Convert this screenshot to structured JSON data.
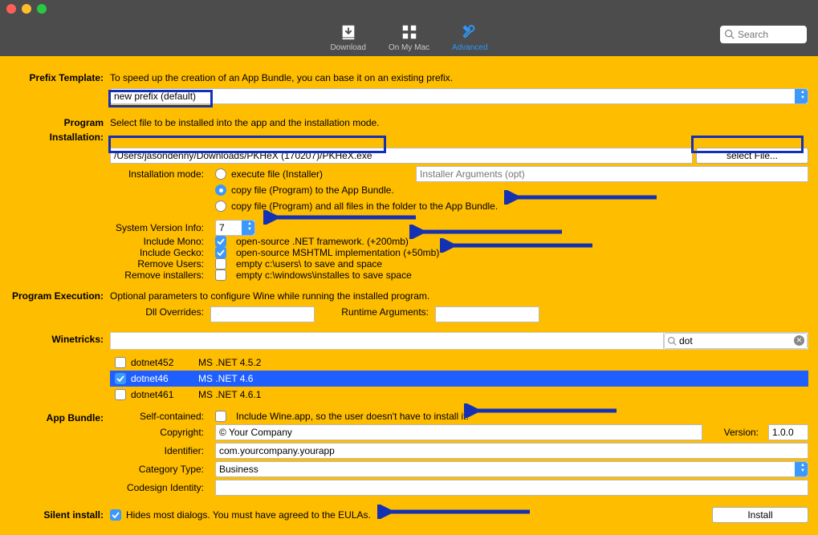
{
  "window": {
    "tabs": [
      "Download",
      "On My Mac",
      "Advanced"
    ],
    "search_placeholder": "Search"
  },
  "prefix": {
    "label": "Prefix Template:",
    "hint": "To speed up the creation of an App Bundle, you can base it on an existing prefix.",
    "value": "new prefix (default)"
  },
  "install": {
    "label": "Program Installation:",
    "hint": "Select file to be installed into the app and the installation mode.",
    "path": "/Users/jasondenny/Downloads/PKHeX (170207)/PKHeX.exe",
    "select_file_btn": "select File...",
    "mode_label": "Installation mode:",
    "modes": [
      "execute file (Installer)",
      "copy file (Program)  to the App Bundle.",
      "copy file (Program)  and all files in the folder to the App Bundle."
    ],
    "installer_args_placeholder": "Installer Arguments (opt)",
    "sysver_label": "System Version Info:",
    "sysver_value": "7",
    "include_mono_label": "Include Mono:",
    "include_mono_text": "open-source .NET framework. (+200mb)",
    "include_gecko_label": "Include Gecko:",
    "include_gecko_text": "open-source MSHTML implementation (+50mb)",
    "remove_users_label": "Remove Users:",
    "remove_users_text": "empty c:\\users\\ to save and space",
    "remove_installers_label": "Remove installers:",
    "remove_installers_text": "empty c:\\windows\\installes to save space"
  },
  "exec": {
    "label": "Program Execution:",
    "hint": "Optional parameters to configure Wine while running the installed program.",
    "dll_label": "Dll Overrides:",
    "runtime_label": "Runtime Arguments:"
  },
  "winetricks": {
    "label": "Winetricks:",
    "search_value": "dot",
    "items": [
      {
        "id": "dotnet452",
        "name": "MS .NET 4.5.2",
        "checked": false,
        "selected": false
      },
      {
        "id": "dotnet46",
        "name": "MS .NET 4.6",
        "checked": true,
        "selected": true
      },
      {
        "id": "dotnet461",
        "name": "MS .NET 4.6.1",
        "checked": false,
        "selected": false
      }
    ]
  },
  "bundle": {
    "label": "App Bundle:",
    "selfcontained_label": "Self-contained:",
    "selfcontained_text": "Include Wine.app, so the user doesn't have to install it.",
    "copyright_label": "Copyright:",
    "copyright_value": "© Your Company",
    "version_label": "Version:",
    "version_value": "1.0.0",
    "identifier_label": "Identifier:",
    "identifier_value": "com.yourcompany.yourapp",
    "category_label": "Category Type:",
    "category_value": "Business",
    "codesign_label": "Codesign Identity:"
  },
  "silent": {
    "label": "Silent install:",
    "text": "Hides most dialogs. You must have agreed to the EULAs."
  },
  "install_btn": "Install"
}
